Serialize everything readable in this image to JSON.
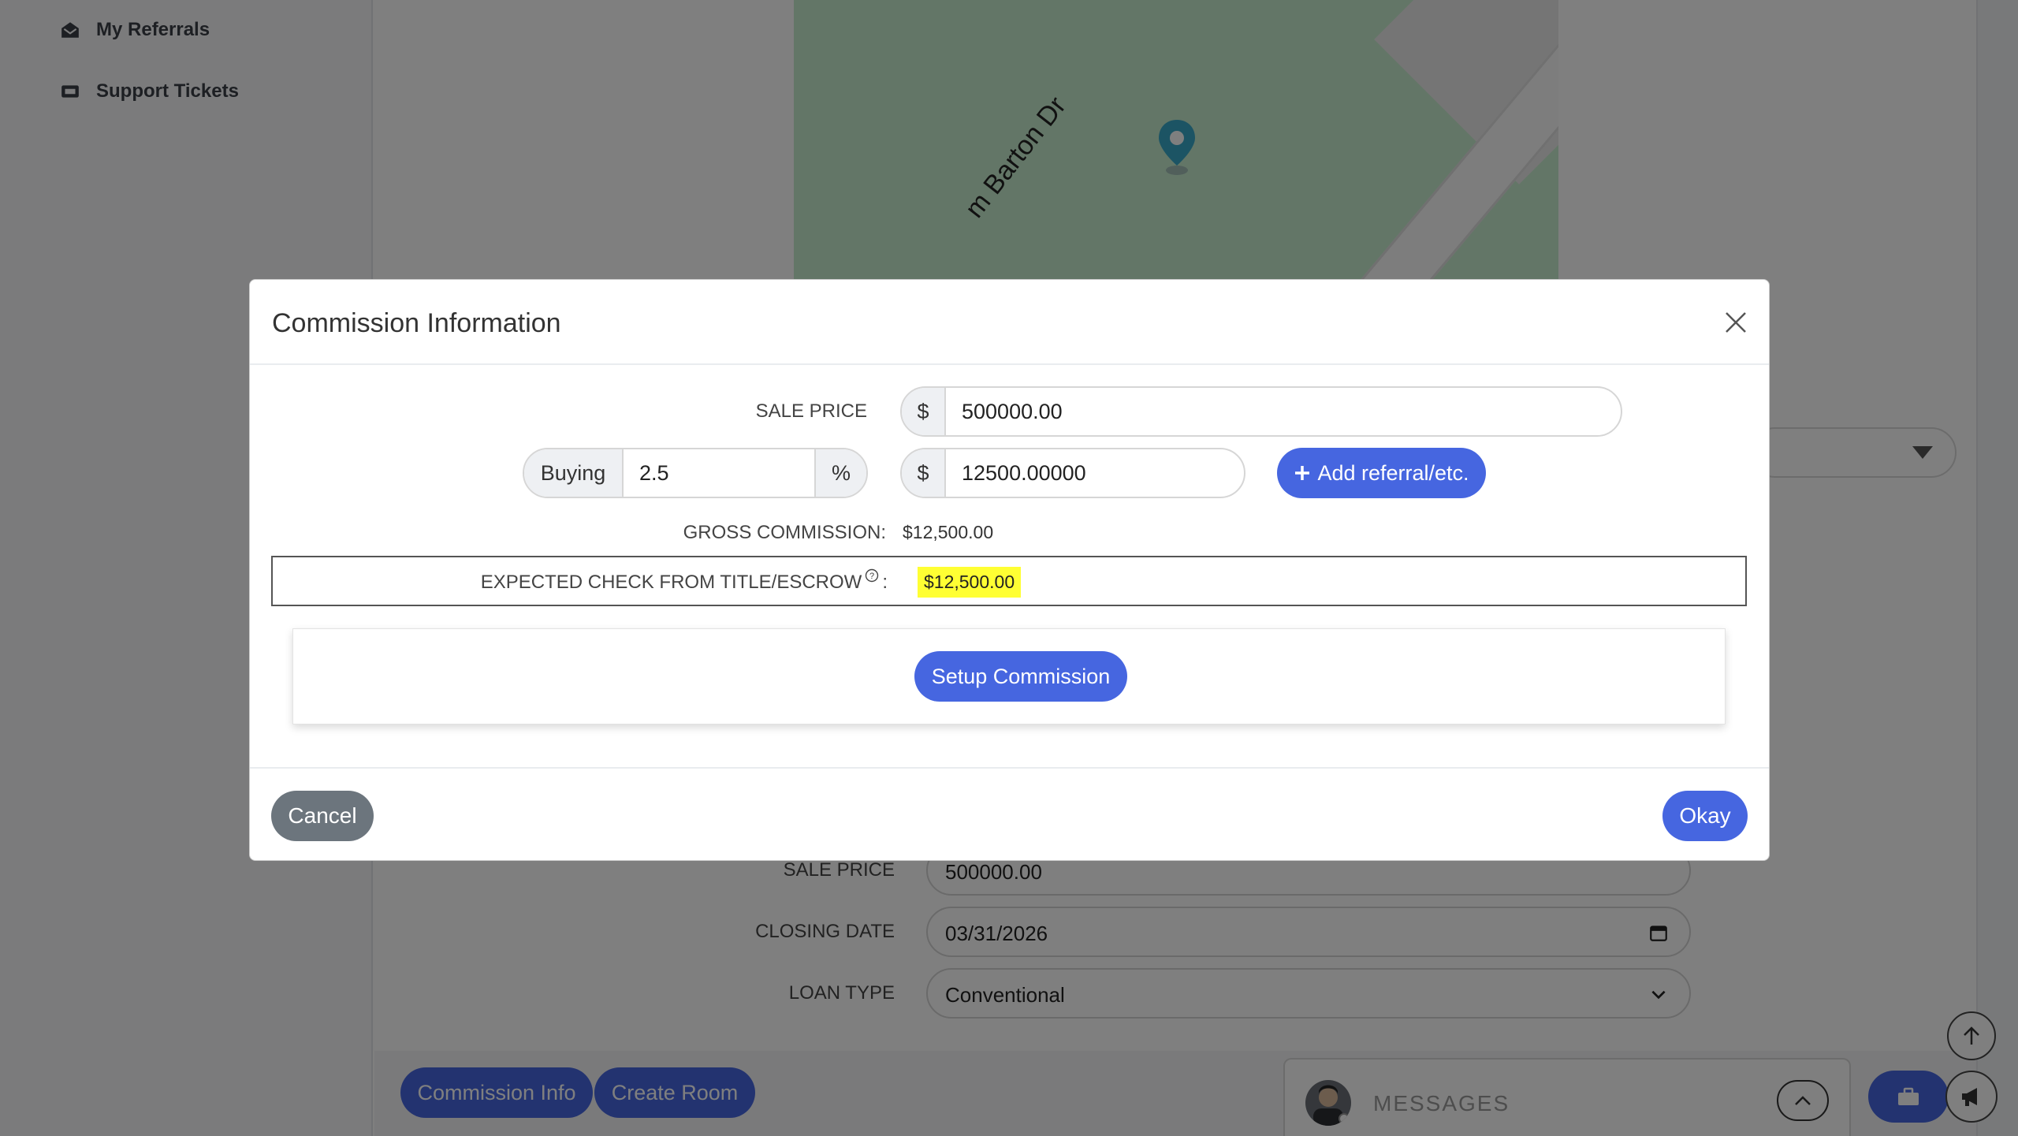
{
  "sidebar": {
    "items": [
      {
        "label": "My Referrals",
        "icon": "envelope-open-icon"
      },
      {
        "label": "Support Tickets",
        "icon": "ticket-icon"
      }
    ]
  },
  "map": {
    "road_label": "m Barton Dr",
    "accent": "#39a9c8"
  },
  "background_form": {
    "sale_price_label": "SALE PRICE",
    "sale_price_value": "500000.00",
    "closing_date_label": "CLOSING DATE",
    "closing_date_value": "03/31/2026",
    "loan_type_label": "LOAN TYPE",
    "loan_type_value": "Conventional"
  },
  "bottom_bar": {
    "commission_info_label": "Commission Info",
    "create_room_label": "Create Room",
    "messages_label": "MESSAGES"
  },
  "modal": {
    "title": "Commission Information",
    "sale_price_label": "SALE PRICE",
    "currency_symbol": "$",
    "sale_price_value": "500000.00",
    "side_label": "Buying",
    "percent_value": "2.5",
    "percent_symbol": "%",
    "commission_amount": "12500.00000",
    "add_referral_label": "Add referral/etc.",
    "gross_commission_label": "GROSS COMMISSION:",
    "gross_commission_value": "$12,500.00",
    "expected_check_label": "EXPECTED CHECK FROM TITLE/ESCROW",
    "expected_check_colon": ":",
    "expected_check_value": "$12,500.00",
    "setup_commission_label": "Setup Commission",
    "cancel_label": "Cancel",
    "okay_label": "Okay"
  },
  "colors": {
    "primary": "#4666e0",
    "secondary": "#6c757d",
    "highlight": "#ffff33"
  }
}
